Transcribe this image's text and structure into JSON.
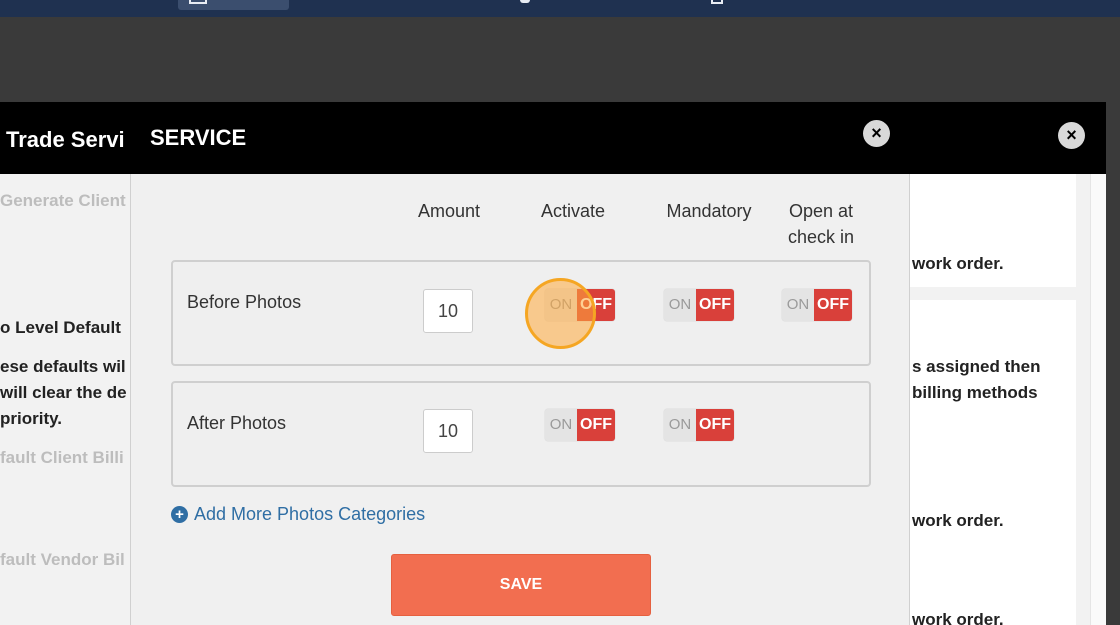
{
  "background_dialog": {
    "title": "Trade Servi",
    "close_icon": "×",
    "left_texts": {
      "generate_client": "Generate Client",
      "level_default": "o Level Default",
      "defaults_line1": "ese defaults wil",
      "defaults_line2": "will clear the de",
      "defaults_line3": "priority.",
      "default_client_billing": "fault Client Billi",
      "default_vendor_billing": "fault Vendor Bil"
    },
    "right_texts": {
      "work_order_1": "work order.",
      "assigned_line1": "s assigned then",
      "assigned_line2": "billing methods",
      "work_order_2": "work order.",
      "work_order_3": "work order."
    }
  },
  "modal": {
    "title": "SERVICE",
    "close_icon": "×",
    "columns": {
      "amount": "Amount",
      "activate": "Activate",
      "mandatory": "Mandatory",
      "open_line1": "Open at",
      "open_line2": "check in"
    },
    "rows": [
      {
        "label": "Before Photos",
        "amount": "10",
        "activate": {
          "on": "ON",
          "off": "OFF"
        },
        "mandatory": {
          "on": "ON",
          "off": "OFF"
        },
        "open_at_check_in": {
          "on": "ON",
          "off": "OFF"
        }
      },
      {
        "label": "After Photos",
        "amount": "10",
        "activate": {
          "on": "ON",
          "off": "OFF"
        },
        "mandatory": {
          "on": "ON",
          "off": "OFF"
        }
      }
    ],
    "add_more_label": "Add More Photos Categories",
    "add_icon": "+",
    "save_label": "SAVE"
  },
  "colors": {
    "topbar": "#1f3150",
    "header": "#000000",
    "toggle_off": "#d9403a",
    "save_button": "#f26e50",
    "link": "#2f6ea4",
    "highlight": "#f5a623"
  }
}
